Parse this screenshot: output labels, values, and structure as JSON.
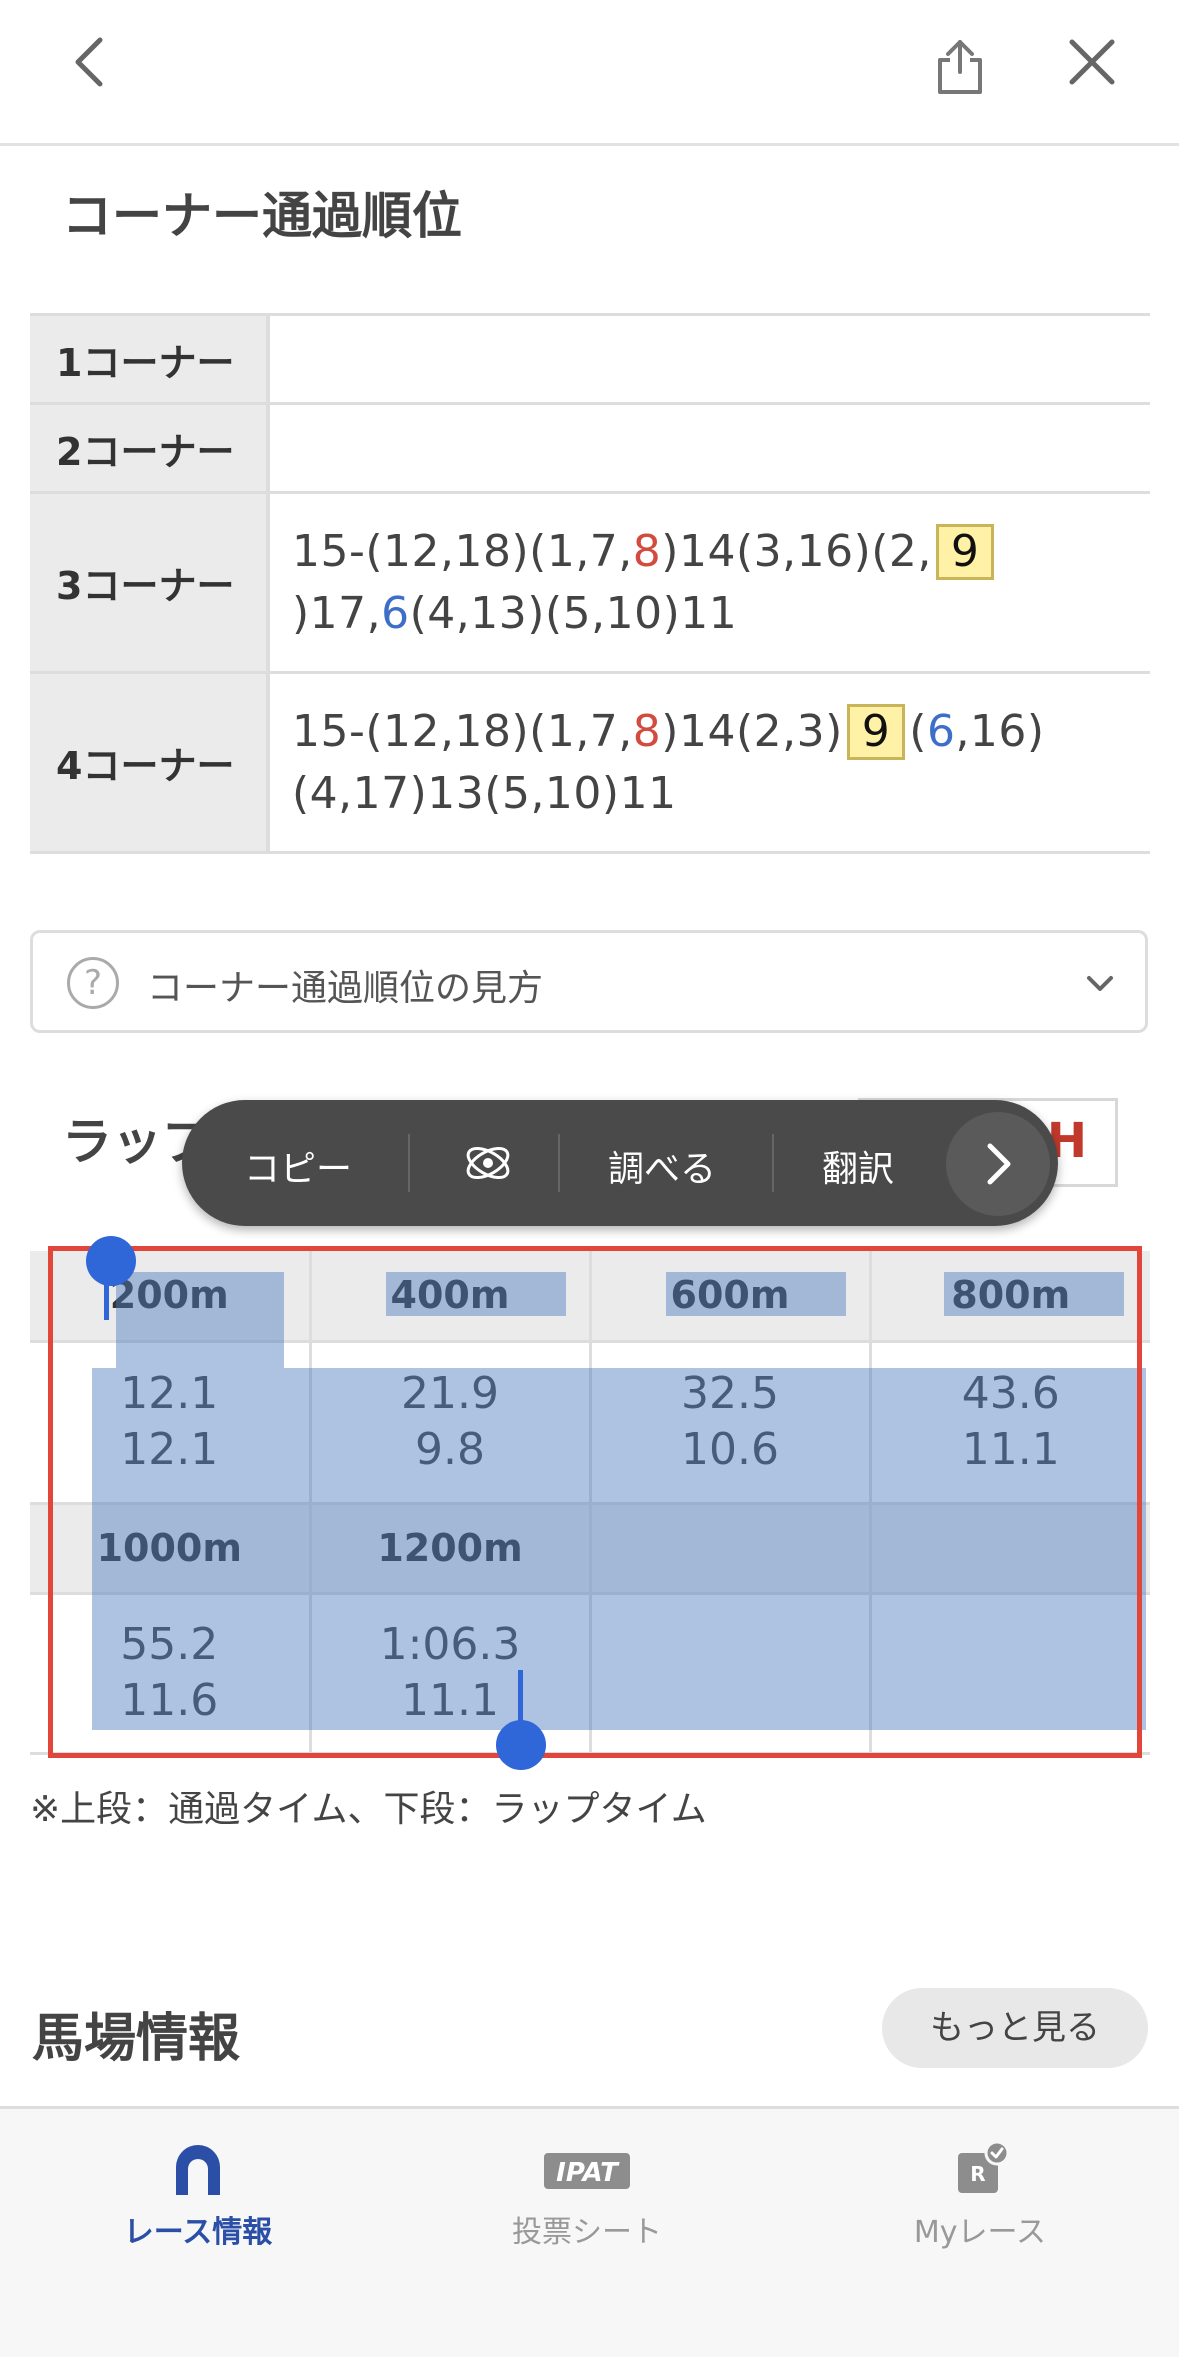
{
  "corner_section": {
    "title": "コーナー通過順位",
    "rows": [
      {
        "label": "1コーナー",
        "parts": []
      },
      {
        "label": "2コーナー",
        "parts": []
      },
      {
        "label": "3コーナー",
        "parts": [
          {
            "t": "15-(12,18)(1,7,"
          },
          {
            "t": "8",
            "style": "red"
          },
          {
            "t": ")14(3,16)(2,"
          },
          {
            "t": "9",
            "style": "box"
          },
          {
            "t": ")17,"
          },
          {
            "t": "6",
            "style": "blue"
          },
          {
            "t": "(4,13)(5,10)11"
          }
        ]
      },
      {
        "label": "4コーナー",
        "parts": [
          {
            "t": "15-(12,18)(1,7,"
          },
          {
            "t": "8",
            "style": "red"
          },
          {
            "t": ")14(2,3)"
          },
          {
            "t": "9",
            "style": "box"
          },
          {
            "t": "("
          },
          {
            "t": "6",
            "style": "blue"
          },
          {
            "t": ",16)(4,17)13(5,10)11"
          }
        ]
      }
    ],
    "howto_label": "コーナー通過順位の見方"
  },
  "lap_section": {
    "title": "ラップ",
    "toggle_right": "H",
    "rows": [
      {
        "heads": [
          "200m",
          "400m",
          "600m",
          "800m"
        ],
        "pass": [
          "12.1",
          "21.9",
          "32.5",
          "43.6"
        ],
        "lap": [
          "12.1",
          "9.8",
          "10.6",
          "11.1"
        ]
      },
      {
        "heads": [
          "1000m",
          "1200m",
          "",
          ""
        ],
        "pass": [
          "55.2",
          "1:06.3",
          "",
          ""
        ],
        "lap": [
          "11.6",
          "11.1",
          "",
          ""
        ]
      }
    ],
    "note": "※上段：通過タイム、下段：ラップタイム"
  },
  "context_menu": {
    "copy": "コピー",
    "lookup": "調べる",
    "translate": "翻訳"
  },
  "track_section": {
    "title": "馬場情報",
    "more_label": "もっと見る"
  },
  "tabbar": {
    "race_info": "レース情報",
    "ipat_icon_text": "IPAT",
    "betting_sheet": "投票シート",
    "my_race": "Myレース",
    "my_race_icon_text": "R"
  },
  "colors": {
    "accent": "#2b4fa6",
    "highlight_red": "#d24b3f",
    "highlight_blue": "#3d6fc9",
    "selection": "#4c78be",
    "selection_frame": "#e2453a"
  }
}
